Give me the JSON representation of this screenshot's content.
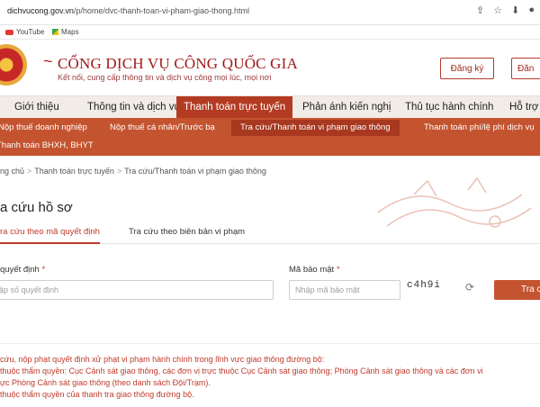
{
  "browser": {
    "url_domain": "dichvucong.gov.vn",
    "url_path": "/p/home/dvc-thanh-toan-vi-pham-giao-thong.html",
    "bookmarks": [
      "YouTube",
      "Maps"
    ]
  },
  "header": {
    "title": "CỔNG DỊCH VỤ CÔNG QUỐC GIA",
    "subtitle": "Kết nối, cung cấp thông tin và dịch vụ công mọi lúc, mọi nơi",
    "register_label": "Đăng ký",
    "login_label": "Đăn"
  },
  "nav": {
    "items": [
      "Giới thiệu",
      "Thông tin và dịch vụ",
      "Thanh toán trực tuyến",
      "Phản ánh kiến nghị",
      "Thủ tục hành chính",
      "Hỗ trợ"
    ],
    "active_index": 2
  },
  "subnav": {
    "items": [
      "Nộp thuế doanh nghiệp",
      "Nộp thuế cá nhân/Trước bạ",
      "Tra cứu/Thanh toán vi phạm giao thông",
      "Thanh toán phí/lệ phí dịch vụ",
      "Thanh toán BHXH, BHYT"
    ],
    "active_index": 2
  },
  "breadcrumb": [
    "ng chủ",
    "Thanh toán trực tuyến",
    "Tra cứu/Thanh toán vi phạm giao thông"
  ],
  "page_title": "a cứu hồ sơ",
  "tabs": [
    "ra cứu theo mã quyết định",
    "Tra cứu theo biên bản vi phạm"
  ],
  "form": {
    "decision_label": "quyết định",
    "decision_placeholder": "ập số quyết định",
    "security_label": "Mã bảo mật",
    "security_placeholder": "Nhập mã bảo mật",
    "captcha": "c4h9i",
    "search_button": "Tra c"
  },
  "notes": [
    "cứu, nộp phạt quyết định xử phạt vi phạm hành chính trong lĩnh vực giao thông đường bộ:",
    "thuộc thẩm quyền: Cục Cảnh sát giao thông, các đơn vị trực thuộc Cục Cảnh sát giao thông; Phòng Cảnh sát giao thông và các đơn vi",
    "ực Phòng Cảnh sát giao thông (theo danh sách Đội/Trạm).",
    "thuộc thẩm quyền của thanh tra giao thông đường bộ."
  ],
  "colors": {
    "brand_red": "#a01919",
    "active_nav": "#b33b22",
    "subnav_bg": "#c4542f",
    "nav_bg": "#f1ece6"
  }
}
